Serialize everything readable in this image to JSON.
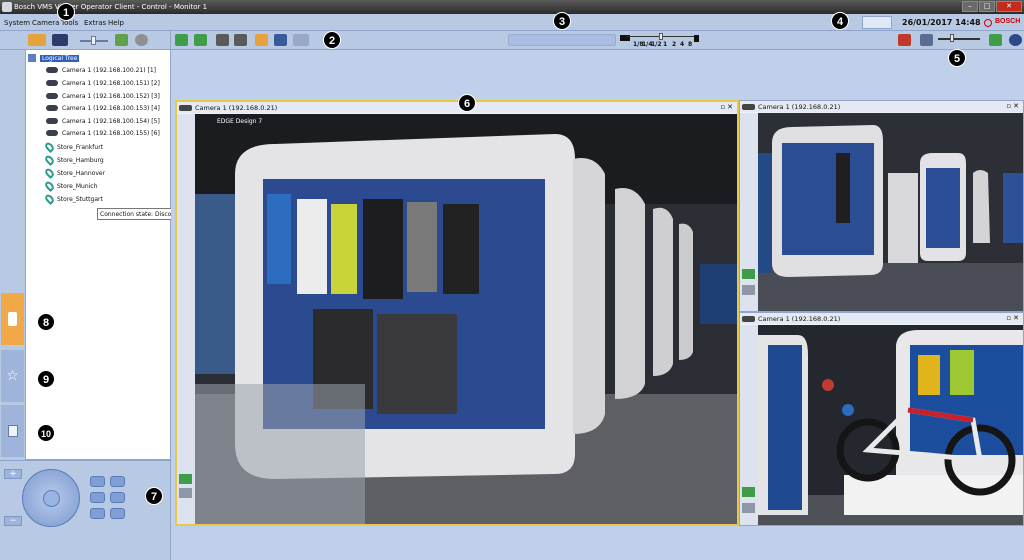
{
  "window": {
    "title": "Bosch VMS Viewer Operator Client - Control - Monitor 1",
    "buttons": [
      "–",
      "□",
      "✕"
    ]
  },
  "menu": [
    "System",
    "Camera",
    "Tools",
    "Extras",
    "Help"
  ],
  "status": {
    "datetime": "26/01/2017 14:48",
    "brand": "BOSCH"
  },
  "playback": {
    "speeds": [
      "1/8",
      "1/4",
      "1/2",
      "1",
      "2",
      "4",
      "8"
    ]
  },
  "tree": {
    "root": "Logical Tree",
    "cameras": [
      "Camera 1 (192.168.100.21) [1]",
      "Camera 1 (192.168.100.151) [2]",
      "Camera 1 (192.168.100.152) [3]",
      "Camera 1 (192.168.100.153) [4]",
      "Camera 1 (192.168.100.154) [5]",
      "Camera 1 (192.168.100.155) [6]"
    ],
    "sites": [
      "Store_Frankfurt",
      "Store_Hamburg",
      "Store_Hannover",
      "Store_Munich",
      "Store_Stuttgart"
    ]
  },
  "tooltip": "Connection state: Disconn",
  "panes": {
    "main": "Camera 1 (192.168.0.21)",
    "top_right": "Camera 1 (192.168.0.21)",
    "bottom_right": "Camera 1 (192.168.0.21)"
  },
  "overlay": "EDGE Design 7",
  "markers": [
    "1",
    "2",
    "3",
    "4",
    "5",
    "6",
    "7",
    "8",
    "9",
    "10"
  ],
  "colors": {
    "accent": "#e6a23c",
    "selection": "#e8c84a",
    "panel": "#b8c9e4"
  }
}
